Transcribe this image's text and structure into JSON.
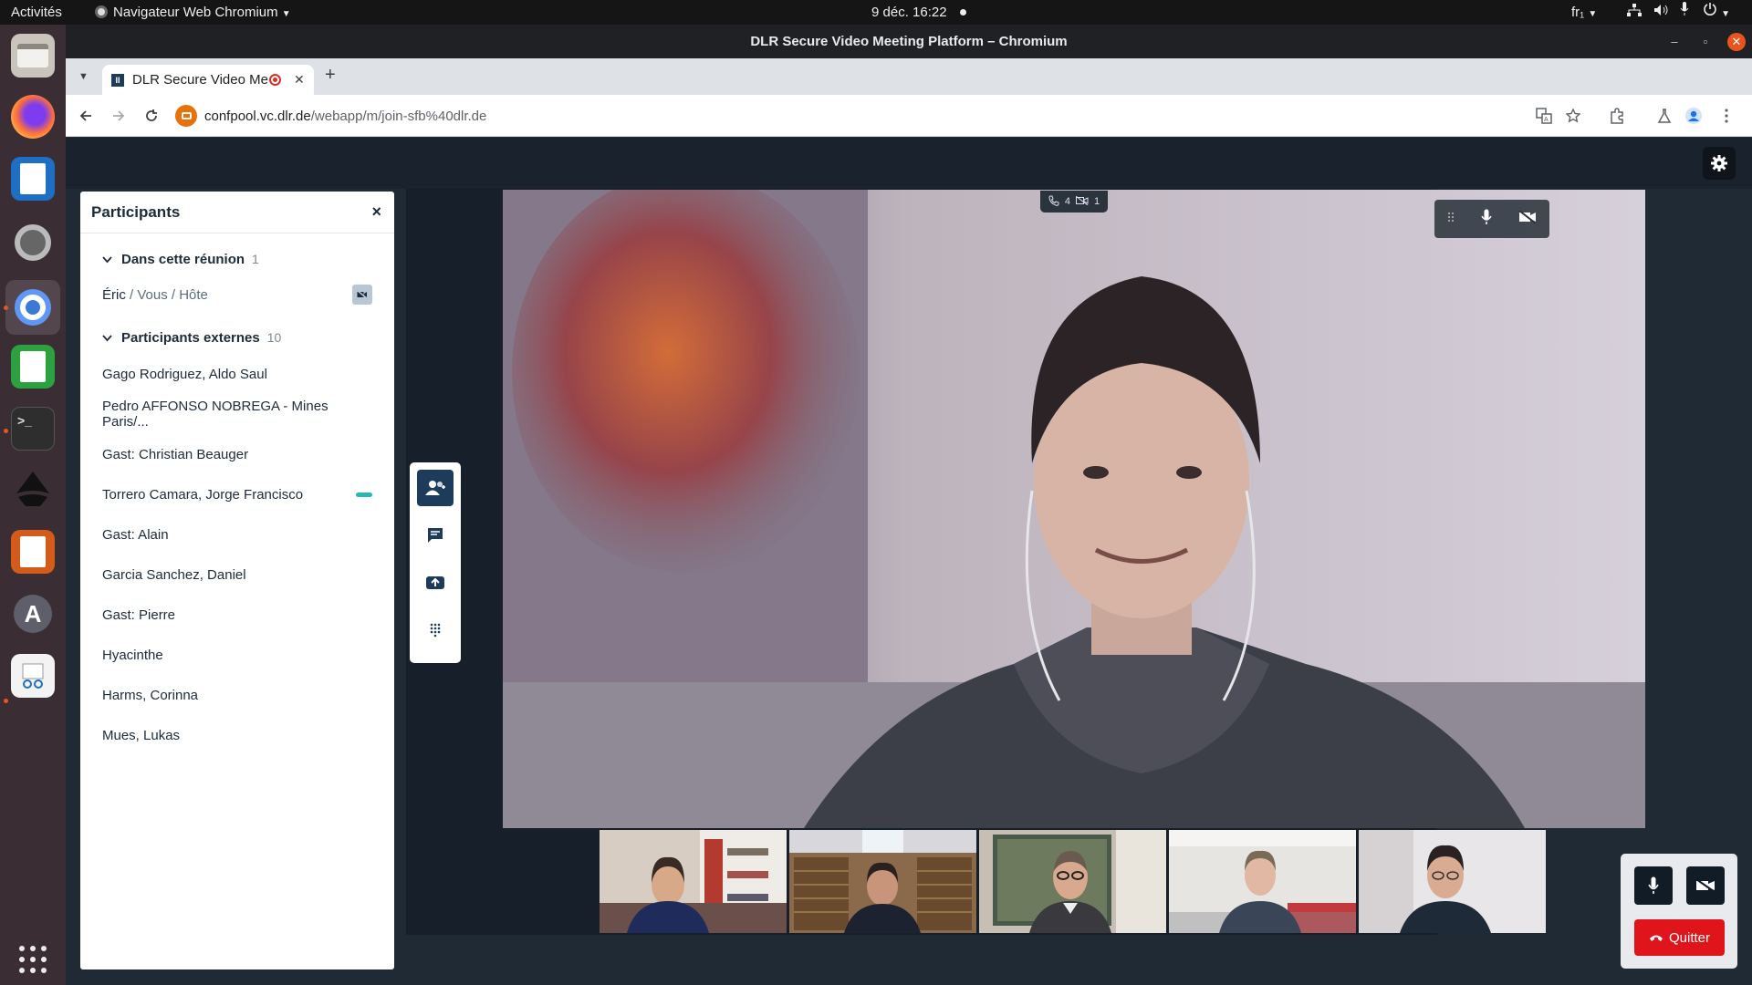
{
  "topbar": {
    "activities": "Activités",
    "app_name": "Navigateur Web Chromium",
    "clock": "9 déc.  16:22",
    "keyboard": "fr₁"
  },
  "window": {
    "title": "DLR Secure Video Meeting Platform – Chromium"
  },
  "browser": {
    "tab_title": "DLR Secure Video Me",
    "new_tab_icon": "plus-icon",
    "url_host": "confpool.vc.dlr.de",
    "url_path": "/webapp/m/join-sfb%40dlr.de"
  },
  "dock": {
    "items": [
      "files",
      "firefox",
      "libreoffice-writer",
      "settings",
      "chromium",
      "libreoffice-calc",
      "terminal",
      "inkscape",
      "libreoffice-impress",
      "software-center",
      "document-viewer",
      "show-apps"
    ]
  },
  "participants_panel": {
    "title": "Participants",
    "close_label": "×",
    "in_meeting": {
      "label": "Dans cette réunion",
      "count": "1",
      "me": {
        "name": "Éric",
        "tags": "/ Vous / Hôte"
      }
    },
    "external": {
      "label": "Participants externes",
      "count": "10",
      "items": [
        "Gago Rodriguez, Aldo Saul",
        "Pedro AFFONSO NOBREGA - Mines Paris/...",
        "Gast: Christian Beauger",
        "Torrero Camara, Jorge Francisco",
        "Gast: Alain",
        "Garcia Sanchez, Daniel",
        "Gast: Pierre",
        "Hyacinthe",
        "Harms, Corinna",
        "Mues, Lukas"
      ]
    }
  },
  "call_stats": {
    "audio_count": "4",
    "video_off_count": "1"
  },
  "call_controls": {
    "quit_label": "Quitter"
  },
  "colors": {
    "accent": "#1d3b5a",
    "active_speaker": "#2ab9b0",
    "quit": "#e0151c"
  }
}
